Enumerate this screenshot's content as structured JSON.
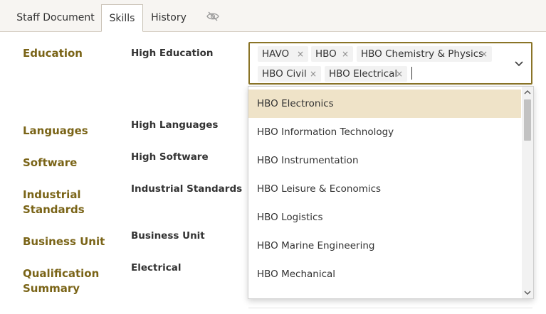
{
  "tabs": [
    {
      "label": "Staff Document"
    },
    {
      "label": "Skills",
      "active": true
    },
    {
      "label": "History"
    }
  ],
  "sections": {
    "education": "Education",
    "languages": "Languages",
    "software": "Software",
    "industrial_standards": "Industrial Standards",
    "business_unit": "Business Unit",
    "qualification_summary": "Qualification Summary"
  },
  "fields": {
    "high_education": "High Education",
    "high_languages": "High Languages",
    "high_software": "High Software",
    "industrial_standards": "Industrial Standards",
    "business_unit": "Business Unit",
    "electrical": "Electrical"
  },
  "multiselect": {
    "selected": [
      "HAVO",
      "HBO",
      "HBO Chemistry & Physics",
      "HBO Civil",
      "HBO Electrical"
    ],
    "remove_glyph": "×"
  },
  "dropdown": {
    "options": [
      "HBO Electronics",
      "HBO Information Technology",
      "HBO Instrumentation",
      "HBO Leisure & Economics",
      "HBO Logistics",
      "HBO Marine Engineering",
      "HBO Mechanical"
    ],
    "highlighted_index": 0
  },
  "colors": {
    "accent": "#7a6417",
    "border_focus": "#8a7427",
    "highlight": "#efe3c8"
  }
}
